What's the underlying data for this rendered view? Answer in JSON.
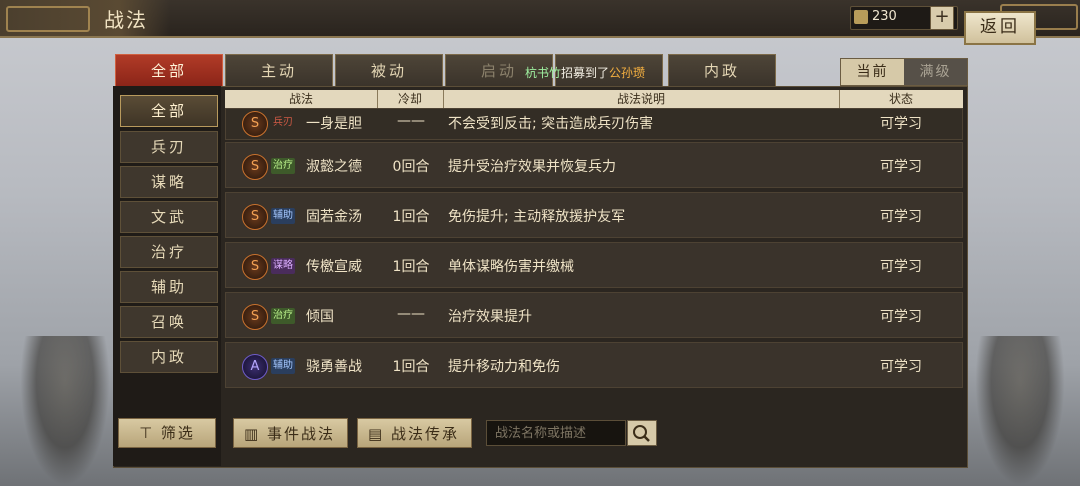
{
  "header": {
    "title": "战法",
    "currency_value": "230",
    "add_label": "+",
    "back_label": "返回"
  },
  "tabs": [
    {
      "label": "全部",
      "active": true
    },
    {
      "label": "主动"
    },
    {
      "label": "被动"
    },
    {
      "label": "启动"
    },
    {
      "label": ""
    },
    {
      "label": "内政"
    }
  ],
  "notice": {
    "part1": "杭书竹",
    "part2": "招募到了",
    "part3": "公孙瓒"
  },
  "toggle": {
    "current": "当前",
    "max": "满级"
  },
  "categories": [
    "全部",
    "兵刃",
    "谋略",
    "文武",
    "治疗",
    "辅助",
    "召唤",
    "内政"
  ],
  "filter_label": "筛选",
  "table": {
    "headers": [
      "战法",
      "冷却",
      "战法说明",
      "状态"
    ],
    "rows": [
      {
        "grade": "S",
        "type": "兵刃",
        "name": "一身是胆",
        "cooldown": "——",
        "desc": "不会受到反击; 突击造成兵刃伤害",
        "status": "可学习"
      },
      {
        "grade": "S",
        "type": "治疗",
        "name": "淑懿之德",
        "cooldown": "0回合",
        "desc": "提升受治疗效果并恢复兵力",
        "status": "可学习"
      },
      {
        "grade": "S",
        "type": "辅助",
        "name": "固若金汤",
        "cooldown": "1回合",
        "desc": "免伤提升; 主动释放援护友军",
        "status": "可学习"
      },
      {
        "grade": "S",
        "type": "谋略",
        "name": "传檄宣威",
        "cooldown": "1回合",
        "desc": "单体谋略伤害并缴械",
        "status": "可学习"
      },
      {
        "grade": "S",
        "type": "治疗",
        "name": "倾国",
        "cooldown": "——",
        "desc": "治疗效果提升",
        "status": "可学习"
      },
      {
        "grade": "A",
        "type": "辅助",
        "name": "骁勇善战",
        "cooldown": "1回合",
        "desc": "提升移动力和免伤",
        "status": "可学习"
      }
    ]
  },
  "bottom": {
    "event_label": "事件战法",
    "inherit_label": "战法传承",
    "search_placeholder": "战法名称或描述"
  },
  "colors": {
    "accent_red": "#b13b27",
    "gold": "#b89a5d",
    "type_兵刃": "#d05a45",
    "type_治疗": "#8fd06a",
    "type_辅助": "#78a8e8",
    "type_谋略": "#c58af0"
  }
}
